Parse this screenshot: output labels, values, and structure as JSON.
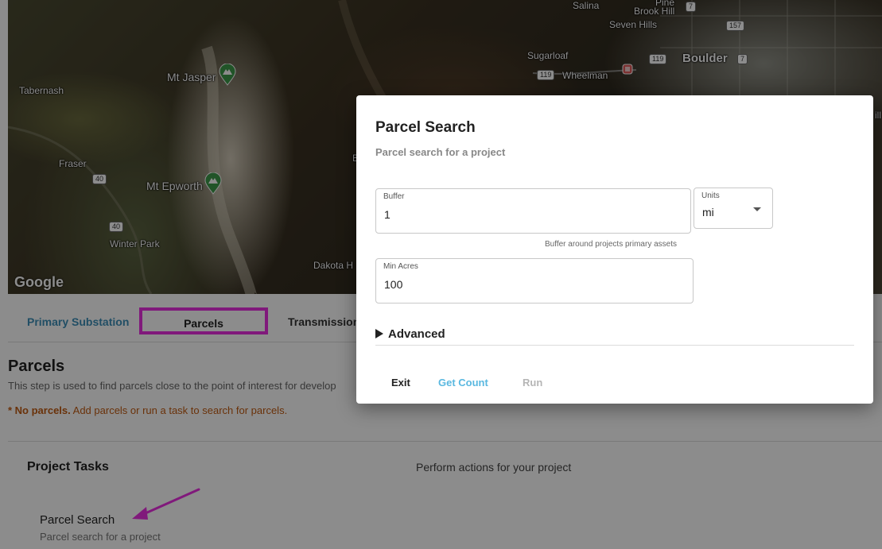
{
  "map": {
    "labels": {
      "salina": "Salina",
      "brook_hill": "Brook Hill",
      "pine": "Pine",
      "seven_hills": "Seven Hills",
      "sugarloaf": "Sugarloaf",
      "boulder": "Boulder",
      "wheelman": "Wheelman",
      "mt_jasper": "Mt Jasper",
      "tabernash": "Tabernash",
      "fraser": "Fraser",
      "mt_epworth": "Mt Epworth",
      "winter_park": "Winter Park",
      "dakota": "Dakota H",
      "edge_b": "B",
      "edge_ill": "ill"
    },
    "shields": {
      "r7a": "7",
      "r157": "157",
      "r119a": "119",
      "r7b": "7",
      "r119b": "119",
      "r40a": "40",
      "r40b": "40"
    },
    "logo": "Google"
  },
  "tabs": {
    "primary_substation": "Primary Substation",
    "parcels": "Parcels",
    "transmission": "Transmission"
  },
  "section": {
    "title": "Parcels",
    "description": "This step is used to find parcels close to the point of interest for develop",
    "warning_strong": "* No parcels.",
    "warning_text": " Add parcels or run a task to search for parcels."
  },
  "tasks": {
    "title": "Project Tasks",
    "description": "Perform actions for your project",
    "item_name": "Parcel Search",
    "item_sub": "Parcel search for a project"
  },
  "modal": {
    "title": "Parcel Search",
    "subtitle": "Parcel search for a project",
    "buffer_label": "Buffer",
    "buffer_value": "1",
    "units_label": "Units",
    "units_value": "mi",
    "buffer_helper": "Buffer around projects primary assets",
    "min_acres_label": "Min Acres",
    "min_acres_value": "100",
    "advanced_label": "Advanced",
    "exit_label": "Exit",
    "get_count_label": "Get Count",
    "run_label": "Run"
  },
  "colors": {
    "accent_blue": "#5ab8e0",
    "tab_blue": "#3d8fb8",
    "highlight_magenta": "#ea2ee0",
    "warning_orange": "#c25b12",
    "pin_green": "#3c9a4a"
  }
}
